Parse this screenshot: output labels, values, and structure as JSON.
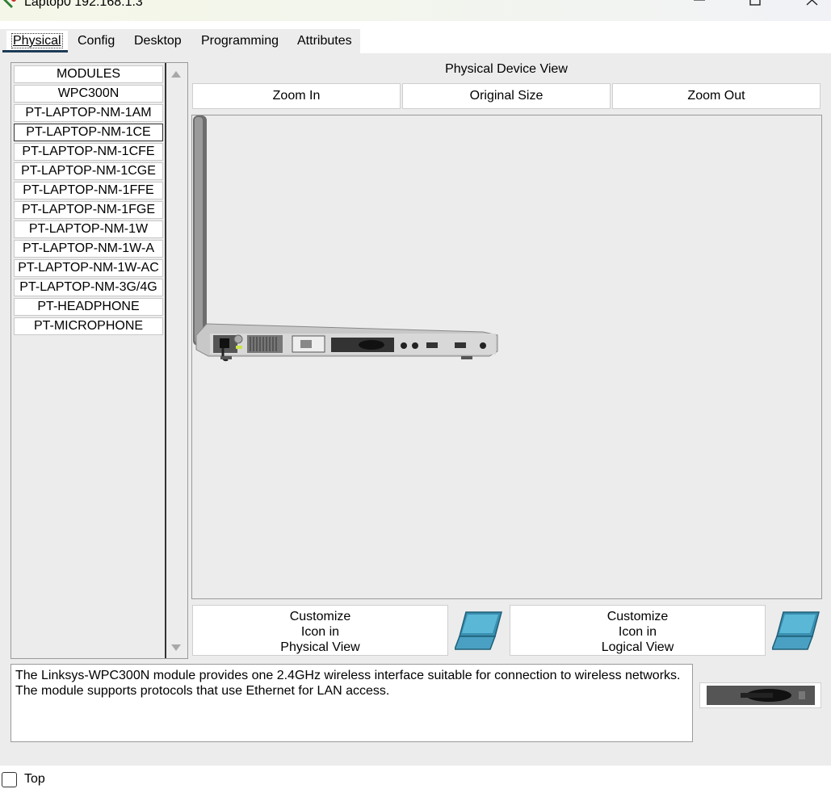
{
  "window": {
    "title": "Laptop0 192.168.1.3",
    "controls": [
      "minimize-icon",
      "maximize-icon",
      "close-icon"
    ]
  },
  "tabs": [
    {
      "label": "Physical",
      "active": true
    },
    {
      "label": "Config",
      "active": false
    },
    {
      "label": "Desktop",
      "active": false
    },
    {
      "label": "Programming",
      "active": false
    },
    {
      "label": "Attributes",
      "active": false
    }
  ],
  "modules": {
    "items": [
      "MODULES",
      "WPC300N",
      "PT-LAPTOP-NM-1AM",
      "PT-LAPTOP-NM-1CE",
      "PT-LAPTOP-NM-1CFE",
      "PT-LAPTOP-NM-1CGE",
      "PT-LAPTOP-NM-1FFE",
      "PT-LAPTOP-NM-1FGE",
      "PT-LAPTOP-NM-1W",
      "PT-LAPTOP-NM-1W-A",
      "PT-LAPTOP-NM-1W-AC",
      "PT-LAPTOP-NM-3G/4G",
      "PT-HEADPHONE",
      "PT-MICROPHONE"
    ],
    "selected": "PT-LAPTOP-NM-1CE"
  },
  "physical_view": {
    "title": "Physical Device View",
    "zoom_in": "Zoom In",
    "original_size": "Original Size",
    "zoom_out": "Zoom Out"
  },
  "customize": {
    "physical": [
      "Customize",
      "Icon in",
      "Physical View"
    ],
    "logical": [
      "Customize",
      "Icon in",
      "Logical View"
    ]
  },
  "description": "The Linksys-WPC300N module provides one 2.4GHz wireless interface suitable for connection to wireless networks. The module supports protocols that use Ethernet for LAN access.",
  "footer": {
    "top_label": "Top",
    "top_checked": false
  },
  "colors": {
    "panel_bg": "#ececec",
    "tab_underline": "#1c3b56",
    "laptop_icon": "#3a8fb0"
  }
}
